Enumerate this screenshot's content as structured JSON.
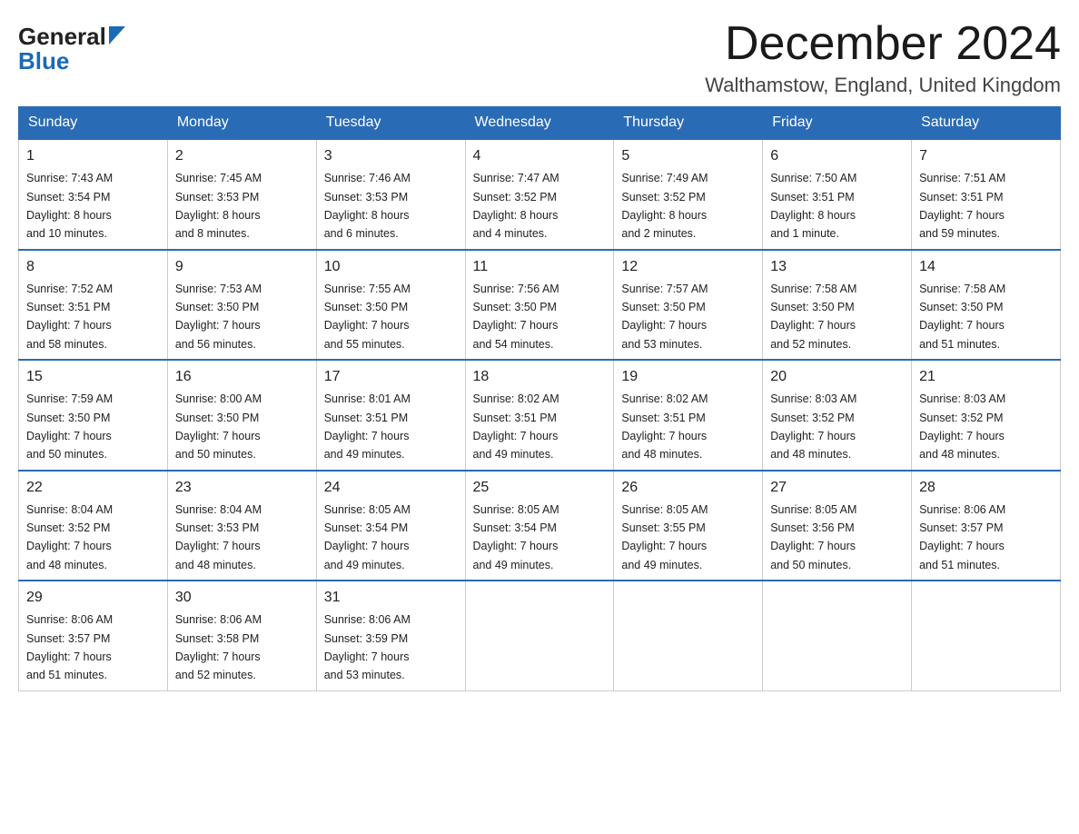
{
  "header": {
    "logo_general": "General",
    "logo_blue": "Blue",
    "month_title": "December 2024",
    "location": "Walthamstow, England, United Kingdom"
  },
  "columns": [
    "Sunday",
    "Monday",
    "Tuesday",
    "Wednesday",
    "Thursday",
    "Friday",
    "Saturday"
  ],
  "weeks": [
    [
      {
        "day": "1",
        "sunrise": "Sunrise: 7:43 AM",
        "sunset": "Sunset: 3:54 PM",
        "daylight1": "Daylight: 8 hours",
        "daylight2": "and 10 minutes."
      },
      {
        "day": "2",
        "sunrise": "Sunrise: 7:45 AM",
        "sunset": "Sunset: 3:53 PM",
        "daylight1": "Daylight: 8 hours",
        "daylight2": "and 8 minutes."
      },
      {
        "day": "3",
        "sunrise": "Sunrise: 7:46 AM",
        "sunset": "Sunset: 3:53 PM",
        "daylight1": "Daylight: 8 hours",
        "daylight2": "and 6 minutes."
      },
      {
        "day": "4",
        "sunrise": "Sunrise: 7:47 AM",
        "sunset": "Sunset: 3:52 PM",
        "daylight1": "Daylight: 8 hours",
        "daylight2": "and 4 minutes."
      },
      {
        "day": "5",
        "sunrise": "Sunrise: 7:49 AM",
        "sunset": "Sunset: 3:52 PM",
        "daylight1": "Daylight: 8 hours",
        "daylight2": "and 2 minutes."
      },
      {
        "day": "6",
        "sunrise": "Sunrise: 7:50 AM",
        "sunset": "Sunset: 3:51 PM",
        "daylight1": "Daylight: 8 hours",
        "daylight2": "and 1 minute."
      },
      {
        "day": "7",
        "sunrise": "Sunrise: 7:51 AM",
        "sunset": "Sunset: 3:51 PM",
        "daylight1": "Daylight: 7 hours",
        "daylight2": "and 59 minutes."
      }
    ],
    [
      {
        "day": "8",
        "sunrise": "Sunrise: 7:52 AM",
        "sunset": "Sunset: 3:51 PM",
        "daylight1": "Daylight: 7 hours",
        "daylight2": "and 58 minutes."
      },
      {
        "day": "9",
        "sunrise": "Sunrise: 7:53 AM",
        "sunset": "Sunset: 3:50 PM",
        "daylight1": "Daylight: 7 hours",
        "daylight2": "and 56 minutes."
      },
      {
        "day": "10",
        "sunrise": "Sunrise: 7:55 AM",
        "sunset": "Sunset: 3:50 PM",
        "daylight1": "Daylight: 7 hours",
        "daylight2": "and 55 minutes."
      },
      {
        "day": "11",
        "sunrise": "Sunrise: 7:56 AM",
        "sunset": "Sunset: 3:50 PM",
        "daylight1": "Daylight: 7 hours",
        "daylight2": "and 54 minutes."
      },
      {
        "day": "12",
        "sunrise": "Sunrise: 7:57 AM",
        "sunset": "Sunset: 3:50 PM",
        "daylight1": "Daylight: 7 hours",
        "daylight2": "and 53 minutes."
      },
      {
        "day": "13",
        "sunrise": "Sunrise: 7:58 AM",
        "sunset": "Sunset: 3:50 PM",
        "daylight1": "Daylight: 7 hours",
        "daylight2": "and 52 minutes."
      },
      {
        "day": "14",
        "sunrise": "Sunrise: 7:58 AM",
        "sunset": "Sunset: 3:50 PM",
        "daylight1": "Daylight: 7 hours",
        "daylight2": "and 51 minutes."
      }
    ],
    [
      {
        "day": "15",
        "sunrise": "Sunrise: 7:59 AM",
        "sunset": "Sunset: 3:50 PM",
        "daylight1": "Daylight: 7 hours",
        "daylight2": "and 50 minutes."
      },
      {
        "day": "16",
        "sunrise": "Sunrise: 8:00 AM",
        "sunset": "Sunset: 3:50 PM",
        "daylight1": "Daylight: 7 hours",
        "daylight2": "and 50 minutes."
      },
      {
        "day": "17",
        "sunrise": "Sunrise: 8:01 AM",
        "sunset": "Sunset: 3:51 PM",
        "daylight1": "Daylight: 7 hours",
        "daylight2": "and 49 minutes."
      },
      {
        "day": "18",
        "sunrise": "Sunrise: 8:02 AM",
        "sunset": "Sunset: 3:51 PM",
        "daylight1": "Daylight: 7 hours",
        "daylight2": "and 49 minutes."
      },
      {
        "day": "19",
        "sunrise": "Sunrise: 8:02 AM",
        "sunset": "Sunset: 3:51 PM",
        "daylight1": "Daylight: 7 hours",
        "daylight2": "and 48 minutes."
      },
      {
        "day": "20",
        "sunrise": "Sunrise: 8:03 AM",
        "sunset": "Sunset: 3:52 PM",
        "daylight1": "Daylight: 7 hours",
        "daylight2": "and 48 minutes."
      },
      {
        "day": "21",
        "sunrise": "Sunrise: 8:03 AM",
        "sunset": "Sunset: 3:52 PM",
        "daylight1": "Daylight: 7 hours",
        "daylight2": "and 48 minutes."
      }
    ],
    [
      {
        "day": "22",
        "sunrise": "Sunrise: 8:04 AM",
        "sunset": "Sunset: 3:52 PM",
        "daylight1": "Daylight: 7 hours",
        "daylight2": "and 48 minutes."
      },
      {
        "day": "23",
        "sunrise": "Sunrise: 8:04 AM",
        "sunset": "Sunset: 3:53 PM",
        "daylight1": "Daylight: 7 hours",
        "daylight2": "and 48 minutes."
      },
      {
        "day": "24",
        "sunrise": "Sunrise: 8:05 AM",
        "sunset": "Sunset: 3:54 PM",
        "daylight1": "Daylight: 7 hours",
        "daylight2": "and 49 minutes."
      },
      {
        "day": "25",
        "sunrise": "Sunrise: 8:05 AM",
        "sunset": "Sunset: 3:54 PM",
        "daylight1": "Daylight: 7 hours",
        "daylight2": "and 49 minutes."
      },
      {
        "day": "26",
        "sunrise": "Sunrise: 8:05 AM",
        "sunset": "Sunset: 3:55 PM",
        "daylight1": "Daylight: 7 hours",
        "daylight2": "and 49 minutes."
      },
      {
        "day": "27",
        "sunrise": "Sunrise: 8:05 AM",
        "sunset": "Sunset: 3:56 PM",
        "daylight1": "Daylight: 7 hours",
        "daylight2": "and 50 minutes."
      },
      {
        "day": "28",
        "sunrise": "Sunrise: 8:06 AM",
        "sunset": "Sunset: 3:57 PM",
        "daylight1": "Daylight: 7 hours",
        "daylight2": "and 51 minutes."
      }
    ],
    [
      {
        "day": "29",
        "sunrise": "Sunrise: 8:06 AM",
        "sunset": "Sunset: 3:57 PM",
        "daylight1": "Daylight: 7 hours",
        "daylight2": "and 51 minutes."
      },
      {
        "day": "30",
        "sunrise": "Sunrise: 8:06 AM",
        "sunset": "Sunset: 3:58 PM",
        "daylight1": "Daylight: 7 hours",
        "daylight2": "and 52 minutes."
      },
      {
        "day": "31",
        "sunrise": "Sunrise: 8:06 AM",
        "sunset": "Sunset: 3:59 PM",
        "daylight1": "Daylight: 7 hours",
        "daylight2": "and 53 minutes."
      },
      null,
      null,
      null,
      null
    ]
  ]
}
